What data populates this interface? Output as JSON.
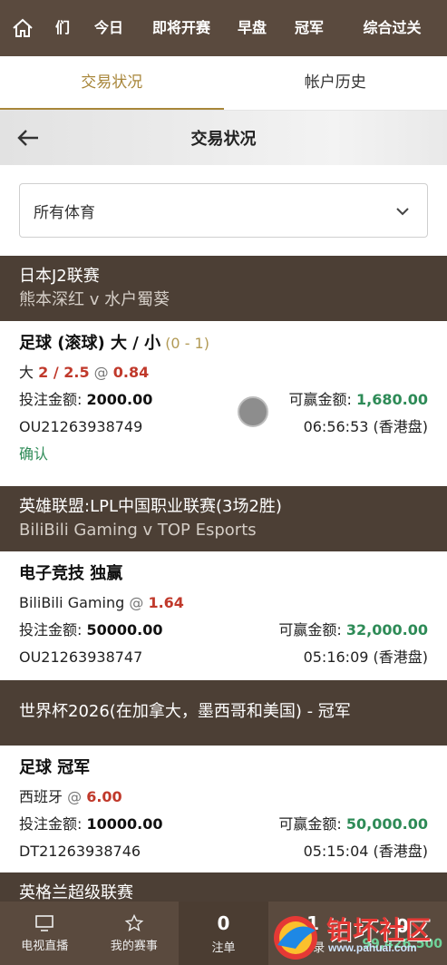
{
  "topnav": {
    "items": [
      "们",
      "今日",
      "即将开赛",
      "早盘",
      "冠军",
      "综合过关"
    ]
  },
  "tabs": [
    "交易状况",
    "帐户历史"
  ],
  "header": {
    "title": "交易状况"
  },
  "filter": {
    "selected": "所有体育"
  },
  "bets": [
    {
      "league": "日本J2联赛",
      "teams": "熊本深红   v  水户蜀葵",
      "market": "足球 (滚球) 大 / 小",
      "score": "(0 - 1)",
      "selection": "大",
      "handicap": "2 / 2.5",
      "at": "@",
      "odds": "0.84",
      "stake_label": "投注金额:",
      "stake": "2000.00",
      "win_label": "可赢金额:",
      "win": "1,680.00",
      "ref": "OU21263938749",
      "time": "06:56:53 (香港盘)",
      "status": "确认"
    },
    {
      "league": "英雄联盟:LPL中国职业联赛(3场2胜)",
      "teams": "BiliBili Gaming   v  TOP Esports",
      "market": "电子竞技 独赢",
      "selection": "BiliBili Gaming",
      "at": "@",
      "odds": "1.64",
      "stake_label": "投注金额:",
      "stake": "50000.00",
      "win_label": "可赢金额:",
      "win": "32,000.00",
      "ref": "OU21263938747",
      "time": "05:16:09 (香港盘)"
    },
    {
      "league": "世界杯2026(在加拿大，墨西哥和美国) - 冠军",
      "market": "足球 冠军",
      "selection": "西班牙",
      "at": "@",
      "odds": "6.00",
      "stake_label": "投注金额:",
      "stake": "10000.00",
      "win_label": "可赢金额:",
      "win": "50,000.00",
      "ref": "DT21263938746",
      "time": "05:15:04 (香港盘)"
    },
    {
      "league": "英格兰超级联赛"
    }
  ],
  "bottombar": {
    "tv_label": "电视直播",
    "my_events_label": "我的赛事",
    "bets_count": "0",
    "bets_label": "注单",
    "records_count": "1",
    "records_label": "记录",
    "balance_count": "0",
    "balance": "99,426.500"
  },
  "watermark": {
    "title": "铂坏社区",
    "site": "www.pahuai.com"
  },
  "colors": {
    "brown": "#5a4a3e",
    "gold": "#a8863a",
    "red": "#c0392b",
    "green": "#2e8b57"
  }
}
